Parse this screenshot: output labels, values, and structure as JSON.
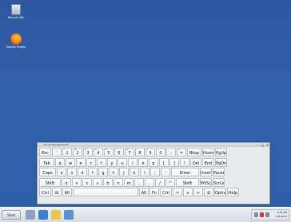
{
  "desktop": {
    "icons": [
      {
        "label": "Recycle Bin"
      },
      {
        "label": "Mozilla Firefox"
      }
    ]
  },
  "osk": {
    "title": "On-Screen Keyboard",
    "rows": [
      [
        "Esc",
        "`",
        "1",
        "2",
        "3",
        "4",
        "5",
        "6",
        "7",
        "8",
        "9",
        "0",
        "-",
        "=",
        "Bksp",
        "Home",
        "PgUp"
      ],
      [
        "Tab",
        "q",
        "w",
        "e",
        "r",
        "t",
        "y",
        "u",
        "i",
        "o",
        "p",
        "[",
        "]",
        "\\",
        "Del",
        "End",
        "PgDn"
      ],
      [
        "Caps",
        "a",
        "s",
        "d",
        "f",
        "g",
        "h",
        "j",
        "k",
        "l",
        ";",
        "'",
        "Enter",
        "Insert",
        "Pause"
      ],
      [
        "Shift",
        "z",
        "x",
        "c",
        "v",
        "b",
        "n",
        "m",
        ",",
        ".",
        "/",
        "^",
        "Shift",
        "PrtScn",
        "ScrLk"
      ],
      [
        "Ctrl",
        "⊞",
        "Alt",
        "",
        "Alt",
        "Fn",
        "Ctrl",
        "<",
        "v",
        ">",
        "☰",
        "Options",
        "Help"
      ]
    ],
    "shift_row": [
      "",
      "~",
      "!",
      "@",
      "#",
      "$",
      "%",
      "^",
      "&",
      "*",
      "(",
      ")",
      "_",
      "+"
    ]
  },
  "taskbar": {
    "start_label": "Start",
    "clock_time": "8:51 PM",
    "clock_date": "4/6/2010"
  }
}
